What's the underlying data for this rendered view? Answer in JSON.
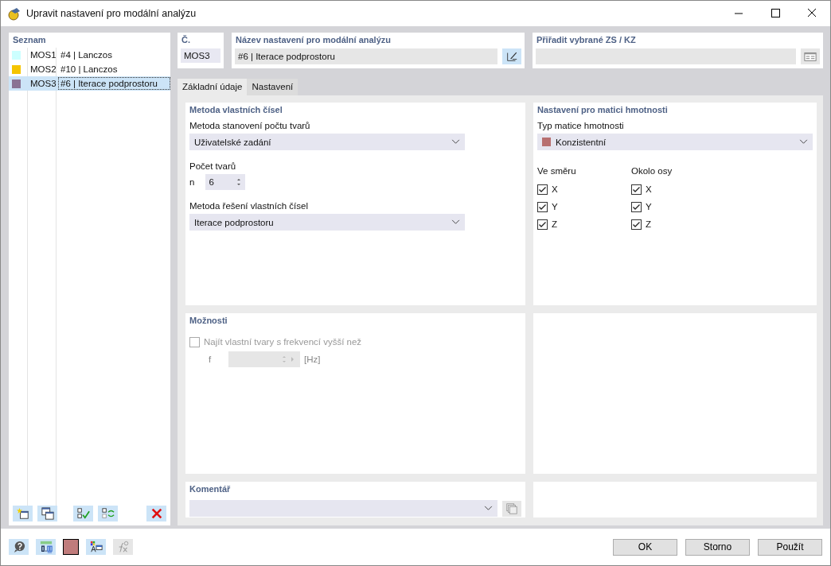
{
  "window": {
    "title": "Upravit nastavení pro modální analýzu"
  },
  "list": {
    "title": "Seznam",
    "items": [
      {
        "color": "#ccffff",
        "id": "MOS1",
        "name": "#4 | Lanczos",
        "selected": false
      },
      {
        "color": "#f5c400",
        "id": "MOS2",
        "name": "#10 | Lanczos",
        "selected": false
      },
      {
        "color": "#8a7394",
        "id": "MOS3",
        "name": "#6 | Iterace podprostoru",
        "selected": true
      }
    ]
  },
  "number": {
    "label": "Č.",
    "value": "MOS3"
  },
  "name_field": {
    "label": "Název nastavení pro modální analýzu",
    "value": "#6 | Iterace podprostoru"
  },
  "assign": {
    "label": "Přiřadit vybrané ZS / KZ"
  },
  "tabs": [
    {
      "label": "Základní údaje",
      "selected": true
    },
    {
      "label": "Nastavení",
      "selected": false
    }
  ],
  "eigen": {
    "title": "Metoda vlastních čísel",
    "method_label": "Metoda stanovení počtu tvarů",
    "method_value": "Uživatelské zadání",
    "count_label": "Počet tvarů",
    "n_label": "n",
    "n_value": "6",
    "solver_label": "Metoda řešení vlastních čísel",
    "solver_value": "Iterace podprostoru"
  },
  "mass": {
    "title": "Nastavení pro matici hmotnosti",
    "type_label": "Typ matice hmotnosti",
    "type_value": "Konzistentní",
    "direction_label": "Ve směru",
    "rotation_label": "Okolo osy",
    "directions": [
      {
        "label": "X",
        "checked": true
      },
      {
        "label": "Y",
        "checked": true
      },
      {
        "label": "Z",
        "checked": true
      }
    ],
    "rotations": [
      {
        "label": "X",
        "checked": true
      },
      {
        "label": "Y",
        "checked": true
      },
      {
        "label": "Z",
        "checked": true
      }
    ]
  },
  "options": {
    "title": "Možnosti",
    "find_label": "Najít vlastní tvary s frekvencí vyšší než",
    "find_checked": false,
    "f_label": "f",
    "unit": "[Hz]"
  },
  "comment": {
    "title": "Komentář"
  },
  "buttons": [
    "OK",
    "Storno",
    "Použít"
  ]
}
